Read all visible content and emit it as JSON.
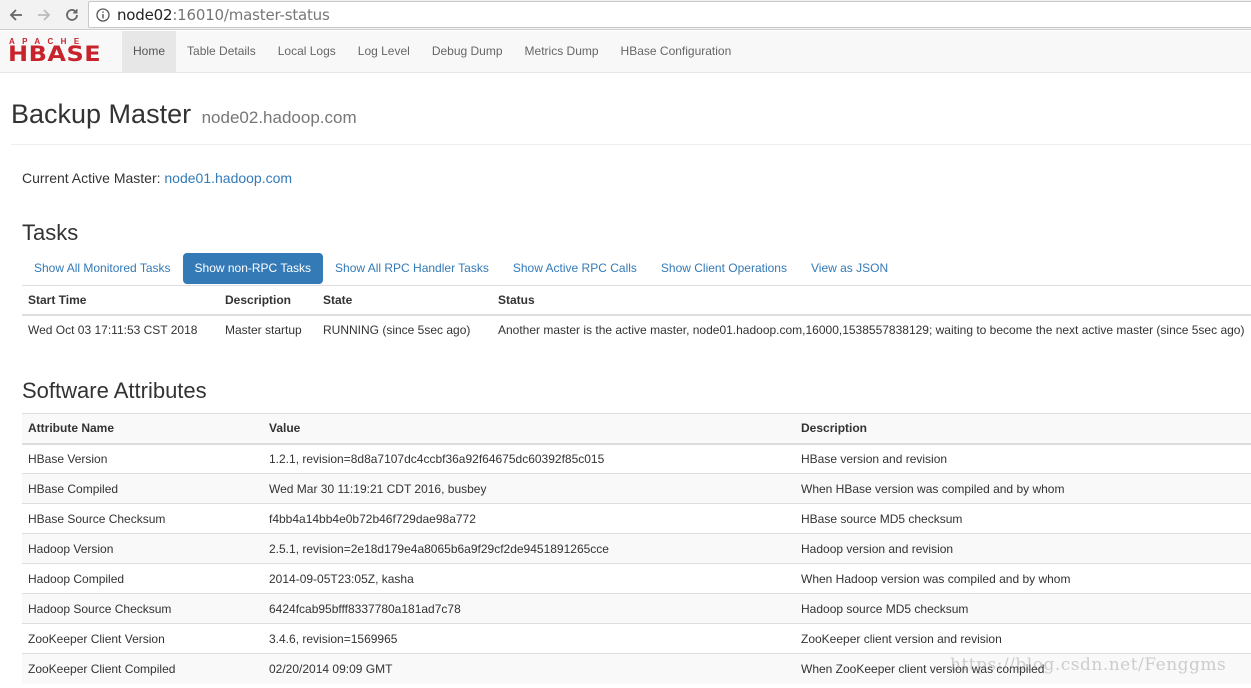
{
  "browser": {
    "url_host": "node02",
    "url_rest": ":16010/master-status"
  },
  "nav": {
    "logo_top": "APACHE",
    "logo_main": "HBASE",
    "links": [
      "Home",
      "Table Details",
      "Local Logs",
      "Log Level",
      "Debug Dump",
      "Metrics Dump",
      "HBase Configuration"
    ],
    "active": "Home"
  },
  "header": {
    "title": "Backup Master",
    "host": "node02.hadoop.com"
  },
  "active_master": {
    "label": "Current Active Master:",
    "link": "node01.hadoop.com"
  },
  "tasks": {
    "heading": "Tasks",
    "pills": [
      "Show All Monitored Tasks",
      "Show non-RPC Tasks",
      "Show All RPC Handler Tasks",
      "Show Active RPC Calls",
      "Show Client Operations",
      "View as JSON"
    ],
    "active_pill": "Show non-RPC Tasks",
    "columns": [
      "Start Time",
      "Description",
      "State",
      "Status"
    ],
    "rows": [
      [
        "Wed Oct 03 17:11:53 CST 2018",
        "Master startup",
        "RUNNING (since 5sec ago)",
        "Another master is the active master, node01.hadoop.com,16000,1538557838129; waiting to become the next active master (since 5sec ago)"
      ]
    ]
  },
  "software": {
    "heading": "Software Attributes",
    "columns": [
      "Attribute Name",
      "Value",
      "Description"
    ],
    "rows": [
      [
        "HBase Version",
        "1.2.1, revision=8d8a7107dc4ccbf36a92f64675dc60392f85c015",
        "HBase version and revision"
      ],
      [
        "HBase Compiled",
        "Wed Mar 30 11:19:21 CDT 2016, busbey",
        "When HBase version was compiled and by whom"
      ],
      [
        "HBase Source Checksum",
        "f4bb4a14bb4e0b72b46f729dae98a772",
        "HBase source MD5 checksum"
      ],
      [
        "Hadoop Version",
        "2.5.1, revision=2e18d179e4a8065b6a9f29cf2de9451891265cce",
        "Hadoop version and revision"
      ],
      [
        "Hadoop Compiled",
        "2014-09-05T23:05Z, kasha",
        "When Hadoop version was compiled and by whom"
      ],
      [
        "Hadoop Source Checksum",
        "6424fcab95bfff8337780a181ad7c78",
        "Hadoop source MD5 checksum"
      ],
      [
        "ZooKeeper Client Version",
        "3.4.6, revision=1569965",
        "ZooKeeper client version and revision"
      ],
      [
        "ZooKeeper Client Compiled",
        "02/20/2014 09:09 GMT",
        "When ZooKeeper client version was compiled"
      ]
    ]
  },
  "watermark": "https://blog.csdn.net/Fenggms",
  "colors": {
    "link": "#337ab7",
    "logo_red": "#c8232c",
    "navbar_bg": "#f8f8f8"
  }
}
